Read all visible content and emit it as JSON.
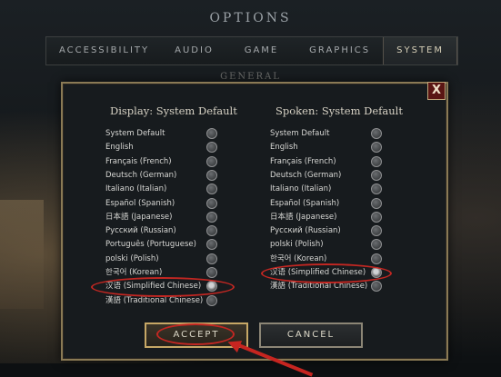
{
  "header": {
    "title": "OPTIONS"
  },
  "tabs": [
    {
      "label": "ACCESSIBILITY"
    },
    {
      "label": "AUDIO"
    },
    {
      "label": "GAME"
    },
    {
      "label": "GRAPHICS"
    },
    {
      "label": "SYSTEM"
    }
  ],
  "section_label": "GENERAL",
  "dialog": {
    "close_label": "X",
    "display_title": "Display: System Default",
    "spoken_title": "Spoken: System Default",
    "display_options": [
      "System Default",
      "English",
      "Français (French)",
      "Deutsch (German)",
      "Italiano (Italian)",
      "Español (Spanish)",
      "日本語 (Japanese)",
      "Pусский (Russian)",
      "Português (Portuguese)",
      "polski (Polish)",
      "한국어 (Korean)",
      "汉语 (Simplified Chinese)",
      "漢語 (Traditional Chinese)"
    ],
    "spoken_options": [
      "System Default",
      "English",
      "Français (French)",
      "Deutsch (German)",
      "Italiano (Italian)",
      "Español (Spanish)",
      "日本語 (Japanese)",
      "Pусский (Russian)",
      "polski (Polish)",
      "한국어 (Korean)",
      "汉语 (Simplified Chinese)",
      "漢語 (Traditional Chinese)"
    ],
    "display_selected": "汉语 (Simplified Chinese)",
    "spoken_selected": "汉语 (Simplified Chinese)",
    "accept_label": "ACCEPT",
    "cancel_label": "CANCEL"
  },
  "colors": {
    "accent_gold": "#c7a866",
    "annotation_red": "#c32722"
  }
}
